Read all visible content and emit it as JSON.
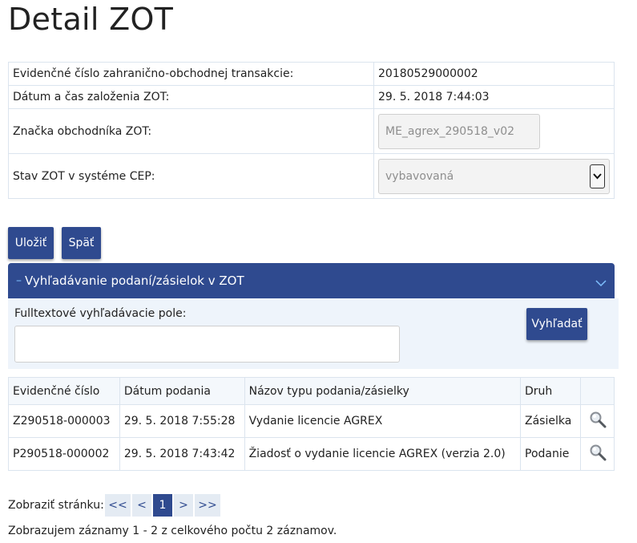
{
  "page": {
    "title": "Detail ZOT"
  },
  "detail": {
    "evidencne_cislo": {
      "label": "Evidenčné číslo zahranično-obchodnej transakcie:",
      "value": "20180529000002"
    },
    "datum_zalozenia": {
      "label": "Dátum a čas založenia ZOT:",
      "value": "29. 5. 2018 7:44:03"
    },
    "znacka": {
      "label": "Značka obchodníka ZOT:",
      "value": "ME_agrex_290518_v02"
    },
    "stav": {
      "label": "Stav ZOT v systéme CEP:",
      "value": "vybavovaná"
    }
  },
  "buttons": {
    "save": "Uložiť",
    "back": "Späť",
    "search": "Vyhľadať"
  },
  "search_panel": {
    "minus_glyph": "–",
    "title": "Vyhľadávanie podaní/zásielok v ZOT",
    "fulltext_label": "Fulltextové vyhľadávacie pole:",
    "fulltext_value": ""
  },
  "results": {
    "headers": [
      "Evidenčné číslo",
      "Dátum podania",
      "Názov typu podania/zásielky",
      "Druh",
      ""
    ],
    "rows": [
      {
        "cislo": "Z290518-000003",
        "datum": "29. 5. 2018 7:55:28",
        "nazov": "Vydanie licencie AGREX",
        "druh": "Zásielka"
      },
      {
        "cislo": "P290518-000002",
        "datum": "29. 5. 2018 7:43:42",
        "nazov": "Žiadosť o vydanie licencie AGREX (verzia 2.0)",
        "druh": "Podanie"
      }
    ]
  },
  "pagination": {
    "label": "Zobraziť stránku:",
    "first": "<<",
    "prev": "<",
    "current": "1",
    "next": ">",
    "last": ">>",
    "summary": "Zobrazujem záznamy 1 - 2 z celkového počtu 2 záznamov."
  },
  "colors": {
    "primary": "#2f4a8f",
    "accent": "#7fc0ff",
    "border": "#dbe4ee"
  }
}
